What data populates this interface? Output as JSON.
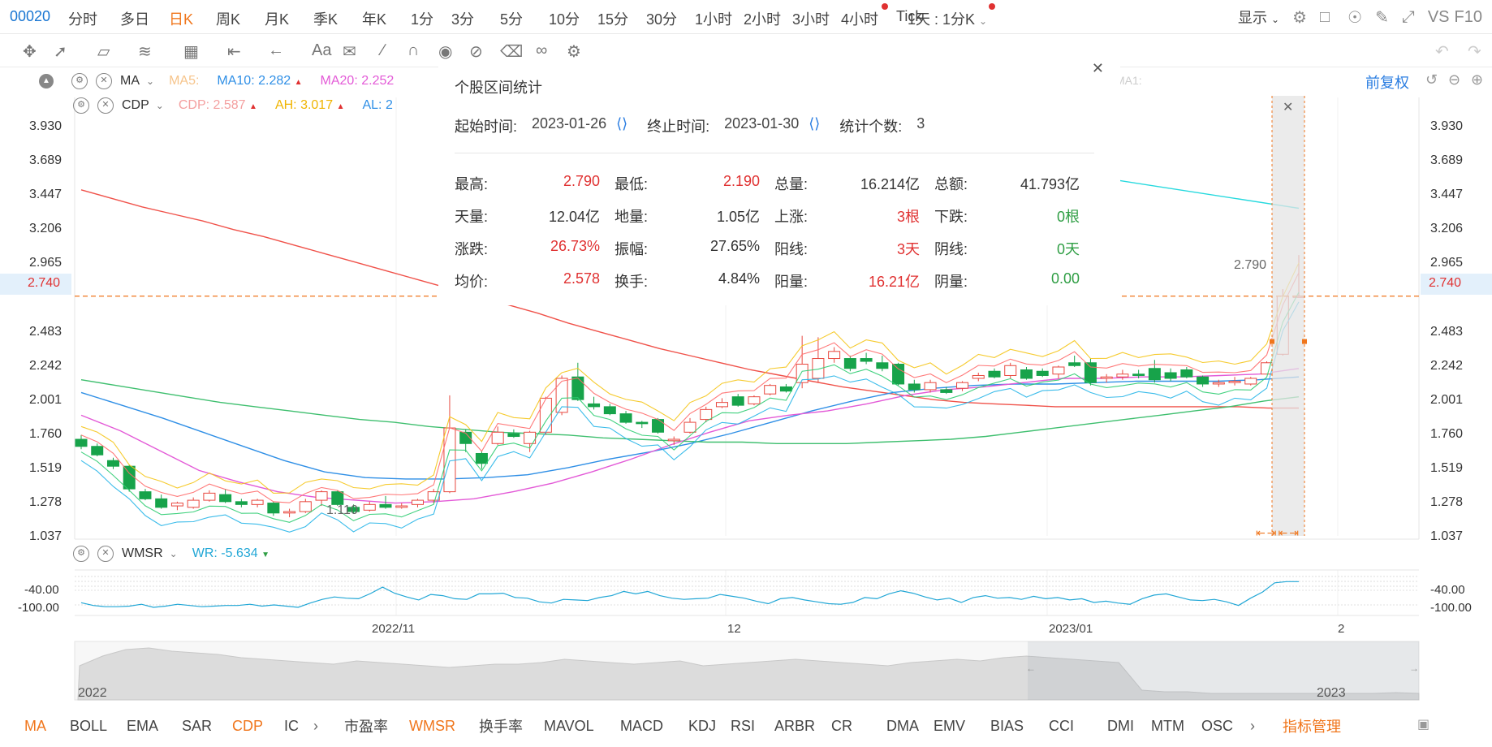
{
  "header": {
    "stock_code": "00020",
    "periods": [
      "分时",
      "多日",
      "日K",
      "周K",
      "月K",
      "季K",
      "年K",
      "1分",
      "3分",
      "5分",
      "10分",
      "15分",
      "30分",
      "1小时",
      "2小时",
      "3小时",
      "4小时",
      "Tick"
    ],
    "active_period": "日K",
    "interval_label": "1天 : 1分K",
    "display_label": "显示",
    "vs_label": "VS",
    "f10_label": "F10"
  },
  "main_legend": {
    "ma": {
      "name": "MA",
      "ma5_label": "MA5:",
      "ma10_label": "MA10:",
      "ma10_value": "2.282",
      "ma20_label": "MA20:",
      "ma20_value": "2.252",
      "ma1_label": "MA1:"
    },
    "cdp": {
      "name": "CDP",
      "cdp_label": "CDP:",
      "cdp_value": "2.587",
      "ah_label": "AH:",
      "ah_value": "3.017",
      "al_label": "AL:",
      "al_value": "2"
    },
    "adjust_label": "前复权"
  },
  "y_axis_ticks": [
    "3.930",
    "3.689",
    "3.447",
    "3.206",
    "2.965",
    "2.740",
    "2.483",
    "2.242",
    "2.001",
    "1.760",
    "1.519",
    "1.278",
    "1.037"
  ],
  "current_price": "2.740",
  "annotations": {
    "high_label": "2.790",
    "low_label": "1.110"
  },
  "x_axis_labels": [
    "2022/11",
    "12",
    "2023/01",
    "2"
  ],
  "sub_indicator": {
    "name": "WMSR",
    "wr_label": "WR:",
    "wr_value": "-5.634",
    "ticks": [
      "-40.00",
      "-100.00"
    ]
  },
  "navigator": {
    "start_year": "2022",
    "end_year": "2023"
  },
  "stats_popup": {
    "title": "个股区间统计",
    "start_label": "起始时间:",
    "start_value": "2023-01-26",
    "end_label": "终止时间:",
    "end_value": "2023-01-30",
    "count_label": "统计个数:",
    "count_value": "3",
    "rows": [
      [
        {
          "k": "最高:",
          "v": "2.790",
          "c": "red"
        },
        {
          "k": "最低:",
          "v": "2.190",
          "c": "red"
        },
        {
          "k": "总量:",
          "v": "16.214亿",
          "c": "plain"
        },
        {
          "k": "总额:",
          "v": "41.793亿",
          "c": "plain"
        }
      ],
      [
        {
          "k": "天量:",
          "v": "12.04亿",
          "c": "plain"
        },
        {
          "k": "地量:",
          "v": "1.05亿",
          "c": "plain"
        },
        {
          "k": "上涨:",
          "v": "3根",
          "c": "red"
        },
        {
          "k": "下跌:",
          "v": "0根",
          "c": "green"
        }
      ],
      [
        {
          "k": "涨跌:",
          "v": "26.73%",
          "c": "red"
        },
        {
          "k": "振幅:",
          "v": "27.65%",
          "c": "plain"
        },
        {
          "k": "阳线:",
          "v": "3天",
          "c": "red"
        },
        {
          "k": "阴线:",
          "v": "0天",
          "c": "green"
        }
      ],
      [
        {
          "k": "均价:",
          "v": "2.578",
          "c": "red"
        },
        {
          "k": "换手:",
          "v": "4.84%",
          "c": "plain"
        },
        {
          "k": "阳量:",
          "v": "16.21亿",
          "c": "red"
        },
        {
          "k": "阴量:",
          "v": "0.00",
          "c": "green"
        }
      ]
    ]
  },
  "indicators": [
    "MA",
    "BOLL",
    "EMA",
    "SAR",
    "CDP",
    "IC",
    "市盈率",
    "WMSR",
    "换手率",
    "MAVOL",
    "MACD",
    "KDJ",
    "RSI",
    "ARBR",
    "CR",
    "DMA",
    "EMV",
    "BIAS",
    "CCI",
    "DMI",
    "MTM",
    "OSC",
    "指标管理"
  ],
  "active_indicators": [
    "MA",
    "CDP",
    "WMSR",
    "指标管理"
  ],
  "chart_data": {
    "type": "candlestick",
    "ylim": [
      0.9,
      4.05
    ],
    "candles": [
      {
        "o": 1.73,
        "h": 1.76,
        "l": 1.66,
        "c": 1.68
      },
      {
        "o": 1.68,
        "h": 1.7,
        "l": 1.61,
        "c": 1.62
      },
      {
        "o": 1.58,
        "h": 1.6,
        "l": 1.52,
        "c": 1.54
      },
      {
        "o": 1.54,
        "h": 1.55,
        "l": 1.36,
        "c": 1.38
      },
      {
        "o": 1.36,
        "h": 1.38,
        "l": 1.3,
        "c": 1.31
      },
      {
        "o": 1.31,
        "h": 1.34,
        "l": 1.24,
        "c": 1.25
      },
      {
        "o": 1.26,
        "h": 1.29,
        "l": 1.23,
        "c": 1.28
      },
      {
        "o": 1.25,
        "h": 1.32,
        "l": 1.24,
        "c": 1.3
      },
      {
        "o": 1.3,
        "h": 1.37,
        "l": 1.29,
        "c": 1.35
      },
      {
        "o": 1.34,
        "h": 1.38,
        "l": 1.28,
        "c": 1.29
      },
      {
        "o": 1.29,
        "h": 1.31,
        "l": 1.25,
        "c": 1.27
      },
      {
        "o": 1.27,
        "h": 1.31,
        "l": 1.25,
        "c": 1.3
      },
      {
        "o": 1.28,
        "h": 1.29,
        "l": 1.19,
        "c": 1.21
      },
      {
        "o": 1.21,
        "h": 1.24,
        "l": 1.18,
        "c": 1.22
      },
      {
        "o": 1.22,
        "h": 1.31,
        "l": 1.21,
        "c": 1.29
      },
      {
        "o": 1.3,
        "h": 1.37,
        "l": 1.26,
        "c": 1.36
      },
      {
        "o": 1.36,
        "h": 1.37,
        "l": 1.26,
        "c": 1.27
      },
      {
        "o": 1.25,
        "h": 1.27,
        "l": 1.21,
        "c": 1.22
      },
      {
        "o": 1.23,
        "h": 1.29,
        "l": 1.22,
        "c": 1.27
      },
      {
        "o": 1.27,
        "h": 1.33,
        "l": 1.24,
        "c": 1.25
      },
      {
        "o": 1.25,
        "h": 1.28,
        "l": 1.24,
        "c": 1.26
      },
      {
        "o": 1.27,
        "h": 1.31,
        "l": 1.25,
        "c": 1.3
      },
      {
        "o": 1.3,
        "h": 1.38,
        "l": 1.28,
        "c": 1.36
      },
      {
        "o": 1.36,
        "h": 2.04,
        "l": 1.35,
        "c": 1.81
      },
      {
        "o": 1.78,
        "h": 1.8,
        "l": 1.64,
        "c": 1.7
      },
      {
        "o": 1.63,
        "h": 1.65,
        "l": 1.52,
        "c": 1.56
      },
      {
        "o": 1.7,
        "h": 1.82,
        "l": 1.69,
        "c": 1.78
      },
      {
        "o": 1.77,
        "h": 1.8,
        "l": 1.74,
        "c": 1.75
      },
      {
        "o": 1.7,
        "h": 1.79,
        "l": 1.64,
        "c": 1.78
      },
      {
        "o": 1.78,
        "h": 2.03,
        "l": 1.76,
        "c": 2.02
      },
      {
        "o": 1.92,
        "h": 2.18,
        "l": 1.9,
        "c": 2.16
      },
      {
        "o": 2.17,
        "h": 2.27,
        "l": 2.0,
        "c": 2.01
      },
      {
        "o": 1.98,
        "h": 2.03,
        "l": 1.94,
        "c": 1.96
      },
      {
        "o": 1.96,
        "h": 1.98,
        "l": 1.9,
        "c": 1.91
      },
      {
        "o": 1.91,
        "h": 1.93,
        "l": 1.84,
        "c": 1.85
      },
      {
        "o": 1.85,
        "h": 1.86,
        "l": 1.81,
        "c": 1.84
      },
      {
        "o": 1.87,
        "h": 1.88,
        "l": 1.77,
        "c": 1.78
      },
      {
        "o": 1.72,
        "h": 1.75,
        "l": 1.69,
        "c": 1.73
      },
      {
        "o": 1.78,
        "h": 1.88,
        "l": 1.77,
        "c": 1.85
      },
      {
        "o": 1.87,
        "h": 1.96,
        "l": 1.85,
        "c": 1.94
      },
      {
        "o": 1.96,
        "h": 2.02,
        "l": 1.95,
        "c": 1.99
      },
      {
        "o": 2.03,
        "h": 2.05,
        "l": 1.96,
        "c": 1.97
      },
      {
        "o": 1.98,
        "h": 2.04,
        "l": 1.97,
        "c": 2.03
      },
      {
        "o": 2.05,
        "h": 2.12,
        "l": 2.04,
        "c": 2.11
      },
      {
        "o": 2.1,
        "h": 2.12,
        "l": 2.06,
        "c": 2.07
      },
      {
        "o": 2.13,
        "h": 2.46,
        "l": 2.09,
        "c": 2.26
      },
      {
        "o": 2.16,
        "h": 2.45,
        "l": 2.13,
        "c": 2.3
      },
      {
        "o": 2.3,
        "h": 2.38,
        "l": 2.27,
        "c": 2.35
      },
      {
        "o": 2.3,
        "h": 2.32,
        "l": 2.21,
        "c": 2.23
      },
      {
        "o": 2.3,
        "h": 2.34,
        "l": 2.26,
        "c": 2.28
      },
      {
        "o": 2.27,
        "h": 2.32,
        "l": 2.21,
        "c": 2.23
      },
      {
        "o": 2.26,
        "h": 2.27,
        "l": 2.11,
        "c": 2.12
      },
      {
        "o": 2.12,
        "h": 2.15,
        "l": 2.06,
        "c": 2.08
      },
      {
        "o": 2.08,
        "h": 2.15,
        "l": 2.06,
        "c": 2.13
      },
      {
        "o": 2.08,
        "h": 2.1,
        "l": 2.05,
        "c": 2.06
      },
      {
        "o": 2.09,
        "h": 2.14,
        "l": 2.07,
        "c": 2.13
      },
      {
        "o": 2.16,
        "h": 2.2,
        "l": 2.14,
        "c": 2.18
      },
      {
        "o": 2.21,
        "h": 2.23,
        "l": 2.16,
        "c": 2.17
      },
      {
        "o": 2.18,
        "h": 2.27,
        "l": 2.16,
        "c": 2.25
      },
      {
        "o": 2.22,
        "h": 2.24,
        "l": 2.15,
        "c": 2.16
      },
      {
        "o": 2.21,
        "h": 2.23,
        "l": 2.17,
        "c": 2.18
      },
      {
        "o": 2.19,
        "h": 2.25,
        "l": 2.16,
        "c": 2.24
      },
      {
        "o": 2.27,
        "h": 2.32,
        "l": 2.24,
        "c": 2.25
      },
      {
        "o": 2.27,
        "h": 2.3,
        "l": 2.11,
        "c": 2.13
      },
      {
        "o": 2.16,
        "h": 2.19,
        "l": 2.13,
        "c": 2.17
      },
      {
        "o": 2.17,
        "h": 2.22,
        "l": 2.15,
        "c": 2.19
      },
      {
        "o": 2.19,
        "h": 2.22,
        "l": 2.16,
        "c": 2.18
      },
      {
        "o": 2.23,
        "h": 2.29,
        "l": 2.13,
        "c": 2.15
      },
      {
        "o": 2.2,
        "h": 2.23,
        "l": 2.14,
        "c": 2.16
      },
      {
        "o": 2.22,
        "h": 2.24,
        "l": 2.16,
        "c": 2.17
      },
      {
        "o": 2.17,
        "h": 2.18,
        "l": 2.1,
        "c": 2.12
      },
      {
        "o": 2.12,
        "h": 2.15,
        "l": 2.1,
        "c": 2.13
      },
      {
        "o": 2.13,
        "h": 2.17,
        "l": 2.11,
        "c": 2.14
      },
      {
        "o": 2.12,
        "h": 2.17,
        "l": 2.11,
        "c": 2.16
      },
      {
        "o": 2.19,
        "h": 2.28,
        "l": 2.19,
        "c": 2.27
      },
      {
        "o": 2.33,
        "h": 2.79,
        "l": 2.32,
        "c": 2.74
      },
      {
        "o": 2.74,
        "h": 3.03,
        "l": 2.74,
        "c": 2.74
      }
    ],
    "ma_lines": [
      {
        "color": "#f0524a",
        "values": [
          3.49,
          3.43,
          3.37,
          3.32,
          3.27,
          3.21,
          3.16,
          3.1,
          3.04,
          2.98,
          2.92,
          2.86,
          2.8,
          2.75,
          2.68,
          2.62,
          2.55,
          2.49,
          2.43,
          2.37,
          2.32,
          2.27,
          2.22,
          2.18,
          2.14,
          2.1,
          2.07,
          2.04,
          2.01,
          1.99,
          1.98,
          1.97,
          1.96,
          1.96,
          1.96,
          1.96,
          1.96,
          1.96,
          1.96,
          1.95,
          1.95
        ]
      },
      {
        "color": "#2f8fe6",
        "values": [
          2.06,
          1.97,
          1.88,
          1.78,
          1.68,
          1.58,
          1.5,
          1.46,
          1.45,
          1.45,
          1.46,
          1.48,
          1.53,
          1.59,
          1.64,
          1.7,
          1.77,
          1.85,
          1.93,
          2.0,
          2.06,
          2.09,
          2.11,
          2.12,
          2.12,
          2.13,
          2.14,
          2.14,
          2.14,
          2.15,
          2.17
        ]
      },
      {
        "color": "#3fbf6f",
        "values": [
          2.15,
          2.11,
          2.07,
          2.03,
          1.99,
          1.96,
          1.93,
          1.9,
          1.87,
          1.85,
          1.82,
          1.8,
          1.78,
          1.77,
          1.76,
          1.74,
          1.73,
          1.72,
          1.71,
          1.71,
          1.7,
          1.7,
          1.7,
          1.71,
          1.72,
          1.73,
          1.75,
          1.78,
          1.81,
          1.84,
          1.87,
          1.9,
          1.93,
          1.96,
          2.0,
          2.03
        ]
      },
      {
        "color": "#e35ad7",
        "values": [
          1.9,
          1.79,
          1.65,
          1.51,
          1.43,
          1.36,
          1.32,
          1.3,
          1.28,
          1.29,
          1.31,
          1.36,
          1.42,
          1.5,
          1.59,
          1.69,
          1.78,
          1.86,
          1.9,
          1.93,
          1.98,
          2.04,
          2.08,
          2.1,
          2.13,
          2.16,
          2.16,
          2.17,
          2.17,
          2.18,
          2.19,
          2.23
        ]
      },
      {
        "color": "#26d9de",
        "values": [
          3.56,
          3.36
        ]
      }
    ],
    "wr": [
      -75,
      -84,
      -88,
      -88,
      -86,
      -80,
      -90,
      -86,
      -80,
      -84,
      -88,
      -86,
      -84,
      -84,
      -80,
      -86,
      -82,
      -86,
      -90,
      -76,
      -64,
      -56,
      -60,
      -62,
      -45,
      -24,
      -44,
      -56,
      -66,
      -48,
      -52,
      -62,
      -64,
      -46,
      -46,
      -44,
      -58,
      -60,
      -72,
      -76,
      -64,
      -66,
      -68,
      -58,
      -52,
      -38,
      -46,
      -38,
      -52,
      -60,
      -64,
      -62,
      -60,
      -48,
      -54,
      -60,
      -70,
      -78,
      -62,
      -58,
      -66,
      -72,
      -78,
      -80,
      -74,
      -58,
      -62,
      -46,
      -36,
      -44,
      -56,
      -66,
      -60,
      -74,
      -58,
      -52,
      -60,
      -58,
      -64,
      -54,
      -62,
      -58,
      -66,
      -62,
      -74,
      -70,
      -76,
      -80,
      -62,
      -50,
      -46,
      -56,
      -66,
      -68,
      -64,
      -72,
      -84,
      -60,
      -40,
      -10,
      -6,
      -6
    ]
  }
}
